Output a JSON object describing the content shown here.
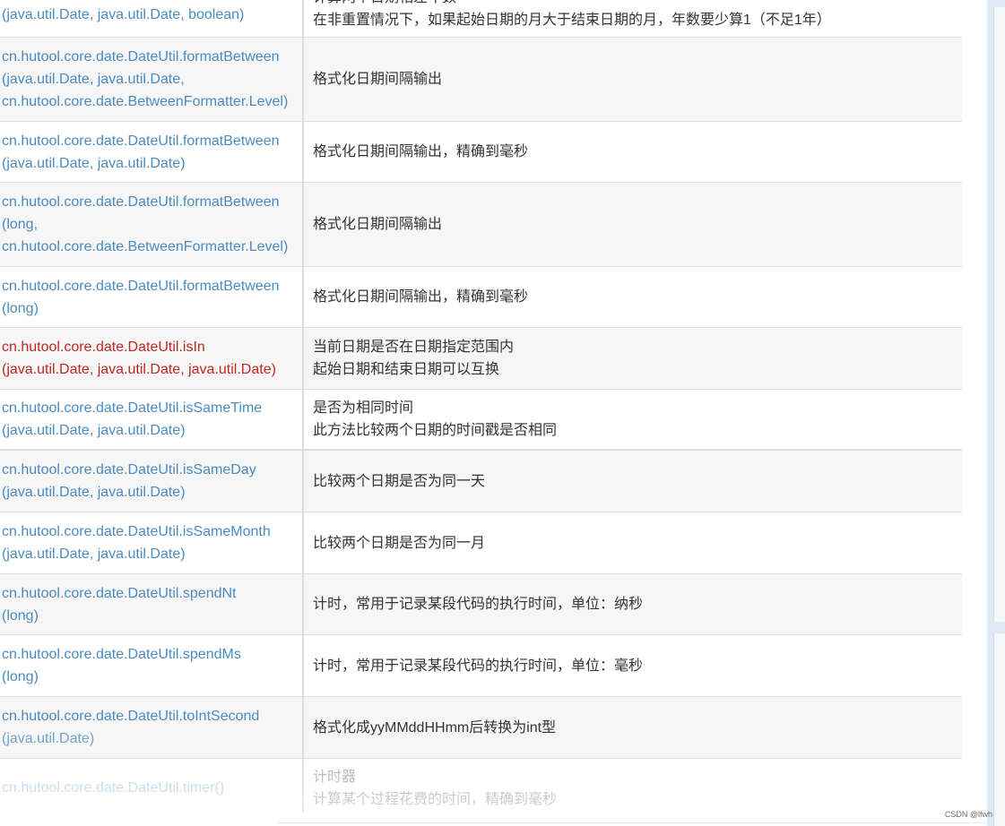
{
  "rows": [
    {
      "method": [
        "(java.util.Date, java.util.Date, boolean)"
      ],
      "desc": [
        "计算两个日期相差年数",
        "在非重置情况下，如果起始日期的月大于结束日期的月，年数要少算1（不足1年）"
      ]
    },
    {
      "method": [
        "cn.hutool.core.date.DateUtil.formatBetween",
        "(java.util.Date, java.util.Date,",
        "cn.hutool.core.date.BetweenFormatter.Level)"
      ],
      "desc": [
        "格式化日期间隔输出"
      ]
    },
    {
      "method": [
        "cn.hutool.core.date.DateUtil.formatBetween",
        "(java.util.Date, java.util.Date)"
      ],
      "desc": [
        "格式化日期间隔输出，精确到毫秒"
      ]
    },
    {
      "method": [
        "cn.hutool.core.date.DateUtil.formatBetween",
        "(long,",
        "cn.hutool.core.date.BetweenFormatter.Level)"
      ],
      "desc": [
        "格式化日期间隔输出"
      ]
    },
    {
      "method": [
        "cn.hutool.core.date.DateUtil.formatBetween",
        "(long)"
      ],
      "desc": [
        "格式化日期间隔输出，精确到毫秒"
      ]
    },
    {
      "method": [
        "cn.hutool.core.date.DateUtil.isIn",
        "(java.util.Date, java.util.Date, java.util.Date)"
      ],
      "desc": [
        "当前日期是否在日期指定范围内",
        "起始日期和结束日期可以互换"
      ]
    },
    {
      "method": [
        "cn.hutool.core.date.DateUtil.isSameTime",
        "(java.util.Date, java.util.Date)"
      ],
      "desc": [
        "是否为相同时间",
        "此方法比较两个日期的时间戳是否相同"
      ]
    },
    {
      "method": [
        "cn.hutool.core.date.DateUtil.isSameDay",
        "(java.util.Date, java.util.Date)"
      ],
      "desc": [
        "比较两个日期是否为同一天"
      ]
    },
    {
      "method": [
        "cn.hutool.core.date.DateUtil.isSameMonth",
        "(java.util.Date, java.util.Date)"
      ],
      "desc": [
        "比较两个日期是否为同一月"
      ]
    },
    {
      "method": [
        "cn.hutool.core.date.DateUtil.spendNt",
        "(long)"
      ],
      "desc": [
        "计时，常用于记录某段代码的执行时间，单位：纳秒"
      ]
    },
    {
      "method": [
        "cn.hutool.core.date.DateUtil.spendMs",
        "(long)"
      ],
      "desc": [
        "计时，常用于记录某段代码的执行时间，单位：毫秒"
      ]
    },
    {
      "method": [
        "cn.hutool.core.date.DateUtil.toIntSecond",
        "(java.util.Date)"
      ],
      "desc": [
        "格式化成yyMMddHHmm后转换为int型"
      ]
    },
    {
      "method": [
        "cn.hutool.core.date.DateUtil.timer()"
      ],
      "desc": [
        "计时器",
        "计算某个过程花费的时间，精确到毫秒"
      ]
    }
  ],
  "watermark": "CSDN @lfwh",
  "colors": {
    "link": "#4a8bc2",
    "highlight": "#c0281f",
    "text": "#333333",
    "stripe": "#f6f6f6"
  }
}
